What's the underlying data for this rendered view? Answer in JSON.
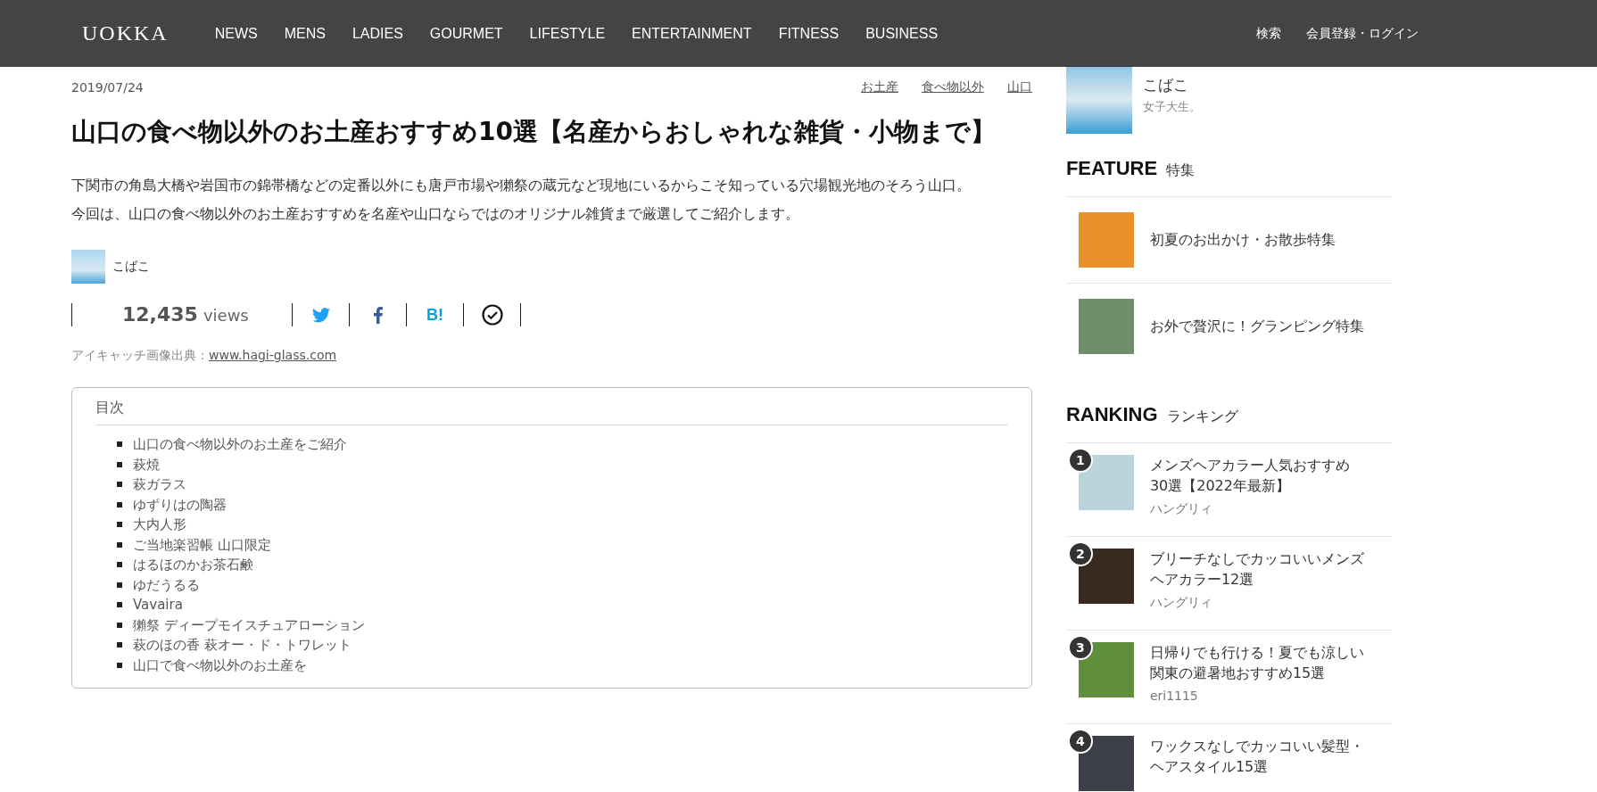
{
  "header": {
    "logo": "UOKKA",
    "nav": [
      "NEWS",
      "MENS",
      "LADIES",
      "GOURMET",
      "LIFESTYLE",
      "ENTERTAINMENT",
      "FITNESS",
      "BUSINESS"
    ],
    "actions": [
      "検索",
      "会員登録・ログイン"
    ]
  },
  "article": {
    "date": "2019/07/24",
    "tags": [
      "お土産",
      "食べ物以外",
      "山口"
    ],
    "title": "山口の食べ物以外のお土産おすすめ10選【名産からおしゃれな雑貨・小物まで】",
    "intro": [
      "下関市の角島大橋や岩国市の錦帯橋などの定番以外にも唐戸市場や獺祭の蔵元など現地にいるからこそ知っている穴場観光地のそろう山口。",
      "今回は、山口の食べ物以外のお土産おすすめを名産や山口ならではのオリジナル雑貨まで厳選してご紹介します。"
    ],
    "author": "こばこ",
    "views": "12,435",
    "views_unit": "views",
    "share": [
      {
        "kind": "twitter"
      },
      {
        "kind": "facebook"
      },
      {
        "kind": "hatena",
        "label": "B!"
      },
      {
        "kind": "check"
      }
    ],
    "credit_label": "アイキャッチ画像出典：",
    "credit_link": "www.hagi-glass.com",
    "toc": {
      "title": "目次",
      "items": [
        "山口の食べ物以外のお土産をご紹介",
        "萩焼",
        "萩ガラス",
        "ゆずりはの陶器",
        "大内人形",
        "ご当地楽習帳 山口限定",
        "はるほのかお茶石鹸",
        "ゆだうるる",
        "Vavaira",
        "獺祭 ディープモイスチュアローション",
        "萩のほの香 萩オー・ド・トワレット",
        "山口で食べ物以外のお土産を"
      ]
    }
  },
  "sidebar": {
    "author": {
      "name": "こばこ",
      "bio": "女子大生。"
    },
    "feature": {
      "title": "FEATURE",
      "subtitle": "特集",
      "items": [
        {
          "title": "初夏のお出かけ・お散歩特集",
          "color": "#e8902a"
        },
        {
          "title": "お外で贅沢に！グランピング特集",
          "color": "#6f8f6a"
        }
      ]
    },
    "ranking": {
      "title": "RANKING",
      "subtitle": "ランキング",
      "items": [
        {
          "rank": "1",
          "title": "メンズヘアカラー人気おすすめ30選【2022年最新】",
          "author": "ハングリィ",
          "color": "#b9d4dc"
        },
        {
          "rank": "2",
          "title": "ブリーチなしでカッコいいメンズヘアカラー12選",
          "author": "ハングリィ",
          "color": "#3a2a20"
        },
        {
          "rank": "3",
          "title": "日帰りでも行ける！夏でも涼しい関東の避暑地おすすめ15選",
          "author": "eri1115",
          "color": "#5f8f3c"
        },
        {
          "rank": "4",
          "title": "ワックスなしでカッコいい髪型・ヘアスタイル15選",
          "color": "#3c3f48"
        }
      ]
    }
  }
}
